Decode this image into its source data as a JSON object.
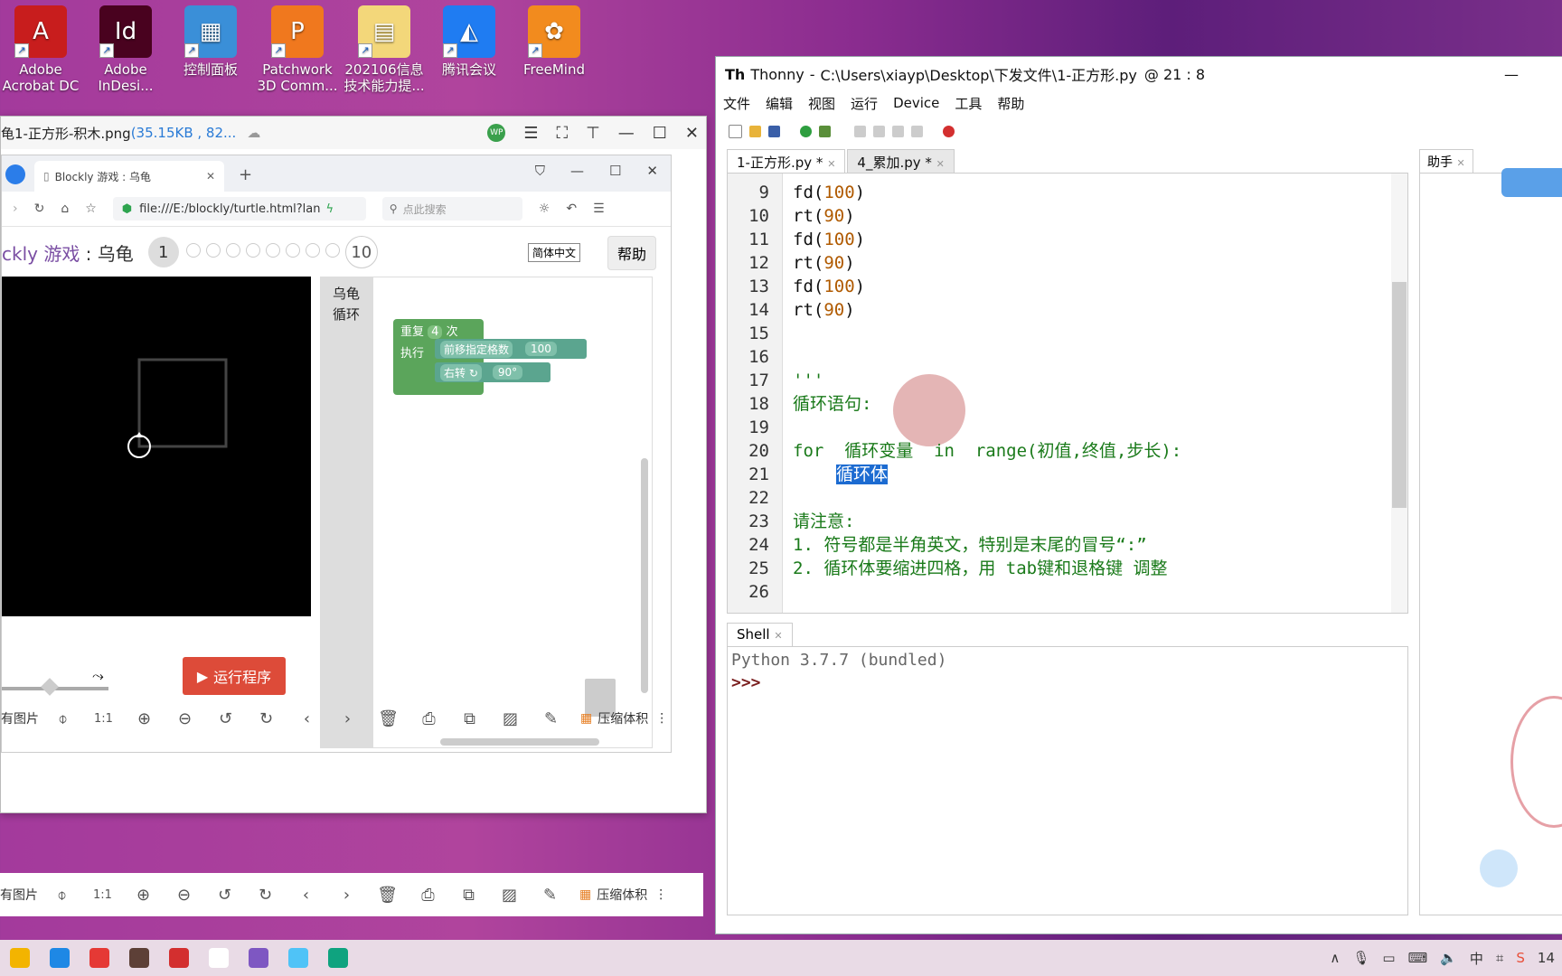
{
  "desktop": {
    "icons": [
      {
        "label": "Adobe Acrobat DC",
        "line1": "Adobe",
        "line2": "Acrobat DC",
        "color": "#c81d1d",
        "glyph": "A"
      },
      {
        "label": "Adobe InDesign",
        "line1": "Adobe",
        "line2": "InDesi...",
        "color": "#49021f",
        "glyph": "Id"
      },
      {
        "label": "控制面板",
        "line1": "控制面板",
        "line2": "",
        "color": "#3a8fd8",
        "glyph": "▦"
      },
      {
        "label": "Patchwork 3D Comm...",
        "line1": "Patchwork",
        "line2": "3D Comm...",
        "color": "#f0781e",
        "glyph": "P"
      },
      {
        "label": "202106信息技术能力提...",
        "line1": "202106信息",
        "line2": "技术能力提...",
        "color": "#f3d77a",
        "glyph": "▤"
      },
      {
        "label": "腾讯会议",
        "line1": "腾讯会议",
        "line2": "",
        "color": "#1f7cf2",
        "glyph": "◭"
      },
      {
        "label": "FreeMind",
        "line1": "FreeMind",
        "line2": "",
        "color": "#f28b1e",
        "glyph": "✿"
      }
    ]
  },
  "viewer": {
    "title_prefix": "龟1-正方形-积木.png",
    "title_meta": " (35.15KB , 82...",
    "toolbar_label": "有图片",
    "compress_label": "压缩体积",
    "zoom_label": "1:1"
  },
  "browser": {
    "tab_title": "Blockly 游戏 : 乌龟",
    "url": "file:///E:/blockly/turtle.html?lan",
    "search_placeholder": "点此搜索",
    "page_title_prefix": "ckly 游戏",
    "page_title_suffix": " : 乌龟",
    "level_current": "1",
    "level_max": "10",
    "language": "简体中文",
    "help": "帮助",
    "toolbox": [
      "乌龟",
      "循环"
    ],
    "block_repeat": "重复",
    "block_repeat_count": "4",
    "block_times": "次",
    "block_do": "执行",
    "block_move": "前移指定格数",
    "block_move_value": "100",
    "block_turn": "右转 ↻",
    "block_turn_value": "90°",
    "run_button": "运行程序"
  },
  "thonny": {
    "title_app": "Thonny",
    "title_path": "C:\\Users\\xiayp\\Desktop\\下发文件\\1-正方形.py",
    "title_pos": "@  21 : 8",
    "menu": [
      "文件",
      "编辑",
      "视图",
      "运行",
      "Device",
      "工具",
      "帮助"
    ],
    "tabs": [
      "1-正方形.py *",
      "4_累加.py *"
    ],
    "assistant_tab": "助手",
    "shell_tab": "Shell",
    "shell_lines": [
      "Python 3.7.7 (bundled)",
      ">>>"
    ],
    "code": [
      {
        "n": "9",
        "text": "fd(100)"
      },
      {
        "n": "10",
        "text": "rt(90)"
      },
      {
        "n": "11",
        "text": "fd(100)"
      },
      {
        "n": "12",
        "text": "rt(90)"
      },
      {
        "n": "13",
        "text": "fd(100)"
      },
      {
        "n": "14",
        "text": "rt(90)"
      },
      {
        "n": "15",
        "text": ""
      },
      {
        "n": "16",
        "text": ""
      },
      {
        "n": "17",
        "text": "'''"
      },
      {
        "n": "18",
        "text": "循环语句:"
      },
      {
        "n": "19",
        "text": ""
      },
      {
        "n": "20",
        "text": "for  循环变量  in  range(初值,终值,步长):"
      },
      {
        "n": "21",
        "text": "循环体"
      },
      {
        "n": "22",
        "text": ""
      },
      {
        "n": "23",
        "text": "请注意:"
      },
      {
        "n": "24",
        "text": "1. 符号都是半角英文，特别是末尾的冒号“:”"
      },
      {
        "n": "25",
        "text": "2. 循环体要缩进四格，用 tab键和退格键 调整"
      },
      {
        "n": "26",
        "text": ""
      }
    ]
  },
  "taskbar": {
    "clock": "14",
    "colors": [
      "#f3b400",
      "#1e88e5",
      "#e53935",
      "#5d4037",
      "#d32f2f",
      "#ffffff",
      "#7e57c2",
      "#4fc3f7",
      "#0fa37f"
    ]
  }
}
